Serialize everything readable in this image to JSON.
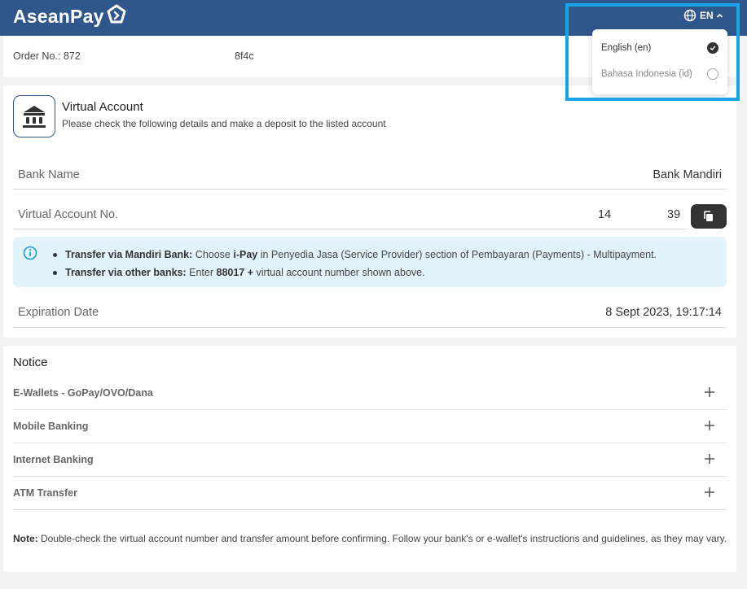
{
  "header": {
    "logo_text": "AseanPay",
    "lang_code": "EN",
    "brand_color": "#2f578c"
  },
  "language_menu": {
    "options": [
      {
        "label": "English (en)",
        "selected": true
      },
      {
        "label": "Bahasa Indonesia (id)",
        "selected": false
      }
    ]
  },
  "order": {
    "label": "Order No.: 872",
    "hash": "8f4c"
  },
  "virtual_account": {
    "title": "Virtual Account",
    "subtitle": "Please check the following details and make a deposit to the listed account",
    "bank_name_label": "Bank Name",
    "bank_name_value": "Bank Mandiri",
    "va_no_label": "Virtual Account No.",
    "va_no_part1": "14",
    "va_no_part2": "39",
    "expiration_label": "Expiration Date",
    "expiration_value": "8 Sept 2023, 19:17:14"
  },
  "info": {
    "line1_bold": "Transfer via Mandiri Bank:",
    "line1_a": " Choose ",
    "line1_ipay": "i-Pay",
    "line1_b": " in Penyedia Jasa (Service Provider) section of Pembayaran (Payments) - Multipayment.",
    "line2_bold": "Transfer via other banks:",
    "line2_a": " Enter ",
    "line2_code": "88017 +",
    "line2_b": " virtual account number shown above."
  },
  "notice": {
    "title": "Notice",
    "items": [
      "E-Wallets - GoPay/OVO/Dana",
      "Mobile Banking",
      "Internet Banking",
      "ATM Transfer"
    ],
    "note_bold": "Note:",
    "note_text": " Double-check the virtual account number and transfer amount before confirming. Follow your bank's or e-wallet's instructions and guidelines, as they may vary."
  }
}
